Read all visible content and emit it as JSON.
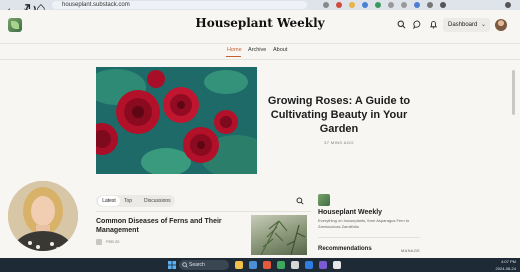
{
  "browser": {
    "url": "houseplant.substack.com"
  },
  "header": {
    "title": "Houseplant Weekly",
    "dashboard_label": "Dashboard"
  },
  "nav": {
    "items": [
      "Home",
      "Archive",
      "About"
    ],
    "active": "Home"
  },
  "hero": {
    "title": "Growing Roses: A Guide to Cultivating Beauty in Your Garden",
    "meta": "37 MINS AGO"
  },
  "tabs": {
    "items": [
      "Latest",
      "Top",
      "Discussions"
    ],
    "active": "Latest"
  },
  "articles": [
    {
      "title": "Common Diseases of Ferns and Their Management",
      "date": "FEB 20"
    }
  ],
  "sidebar": {
    "title": "Houseplant Weekly",
    "description": "Everything on houseplants, from Asparagus Fern to Zamioculcas Zamiifolia",
    "recommendations_label": "Recommendations",
    "manage_label": "MANAGE"
  },
  "taskbar": {
    "search_placeholder": "Search",
    "time": "4:07 PM",
    "date": "2024-08-24"
  },
  "colors": {
    "accent": "#c8602e",
    "taskbar": "#1e2a35"
  }
}
